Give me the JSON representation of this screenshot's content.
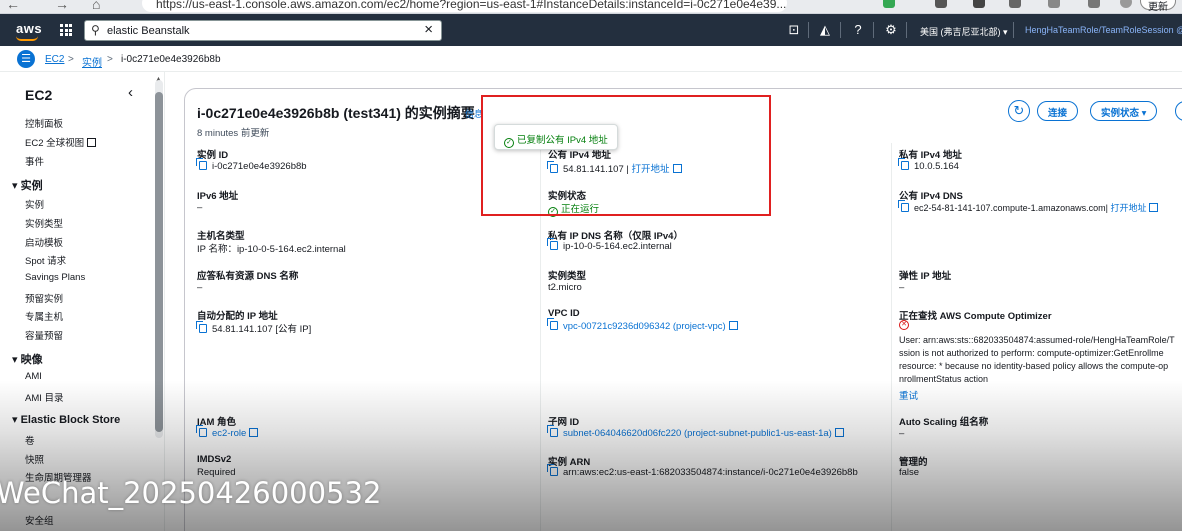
{
  "browser": {
    "url": "https://us-east-1.console.aws.amazon.com/ec2/home?region=us-east-1#InstanceDetails:instanceId=i-0c271e0e4e39...",
    "update_label": "更新"
  },
  "topnav": {
    "logo": "aws",
    "search_value": "elastic Beanstalk",
    "region": "美国 (弗吉尼亚北部) ▾",
    "account": "HengHaTeamRole/TeamRoleSession @"
  },
  "breadcrumb": {
    "items": [
      "EC2",
      "实例",
      "i-0c271e0e4e3926b8b"
    ],
    "separator": ">"
  },
  "sidebar": {
    "title": "EC2",
    "top_items": [
      "控制面板",
      "EC2 全球视图",
      "事件"
    ],
    "sections": [
      {
        "title": "实例",
        "items": [
          "实例",
          "实例类型",
          "启动模板",
          "Spot 请求",
          "Savings Plans",
          "预留实例",
          "专属主机",
          "容量预留"
        ]
      },
      {
        "title": "映像",
        "items": [
          "AMI",
          "AMI 目录"
        ]
      },
      {
        "title": "Elastic Block Store",
        "items": [
          "卷",
          "快照",
          "生命周期管理器"
        ]
      }
    ],
    "bottom_items": [
      "安全组"
    ]
  },
  "summary": {
    "title": "i-0c271e0e4e3926b8b (test341) 的实例摘要",
    "info_link": "信息",
    "updated": "8 minutes 前更新",
    "buttons": {
      "connect": "连接",
      "instance_state": "实例状态 ▾"
    },
    "toast": "已复制公有 IPv4 地址",
    "col1": [
      {
        "label": "实例 ID",
        "value": "i-0c271e0e4e3926b8b"
      },
      {
        "label": "IPv6 地址",
        "value": "–"
      },
      {
        "label": "主机名类型",
        "value": "IP 名称：ip-10-0-5-164.ec2.internal"
      },
      {
        "label": "应答私有资源 DNS 名称",
        "value": "–"
      },
      {
        "label": "自动分配的 IP 地址",
        "value": "54.81.141.107 [公有 IP]"
      },
      {
        "label": "IAM 角色",
        "value": "ec2-role"
      },
      {
        "label": "IMDSv2",
        "value": "Required"
      }
    ],
    "col2": [
      {
        "label": "公有 IPv4 地址",
        "value": "54.81.141.107",
        "link": "打开地址"
      },
      {
        "label": "实例状态",
        "value": "正在运行"
      },
      {
        "label": "私有 IP DNS 名称（仅限 IPv4）",
        "value": "ip-10-0-5-164.ec2.internal"
      },
      {
        "label": "实例类型",
        "value": "t2.micro"
      },
      {
        "label": "VPC ID",
        "value": "vpc-00721c9236d096342 (project-vpc)"
      },
      {
        "label": "子网 ID",
        "value": "subnet-064046620d06fc220 (project-subnet-public1-us-east-1a)"
      },
      {
        "label": "实例 ARN",
        "value": "arn:aws:ec2:us-east-1:682033504874:instance/i-0c271e0e4e3926b8b"
      }
    ],
    "col3": [
      {
        "label": "私有 IPv4 地址",
        "value": "10.0.5.164"
      },
      {
        "label": "公有 IPv4 DNS",
        "value": "ec2-54-81-141-107.compute-1.amazonaws.com",
        "link": "打开地址"
      },
      {
        "label": "弹性 IP 地址",
        "value": "–"
      },
      {
        "label": "正在查找 AWS Compute Optimizer",
        "error_lines": [
          "User: arn:aws:sts::682033504874:assumed-role/HengHaTeamRole/T",
          "ssion is not authorized to perform: compute-optimizer:GetEnrollme",
          "resource: * because no identity-based policy allows the compute-op",
          "nrollmentStatus action"
        ],
        "retry": "重试"
      },
      {
        "label": "Auto Scaling 组名称",
        "value": "–"
      },
      {
        "label": "管理的",
        "value": "false"
      }
    ]
  },
  "colors": {
    "topnav": "#232f3e",
    "link": "#0972d3",
    "success": "#037f0c",
    "error": "#d91515",
    "highlight": "#e02020"
  },
  "watermark": "WeChat_20250426000532"
}
